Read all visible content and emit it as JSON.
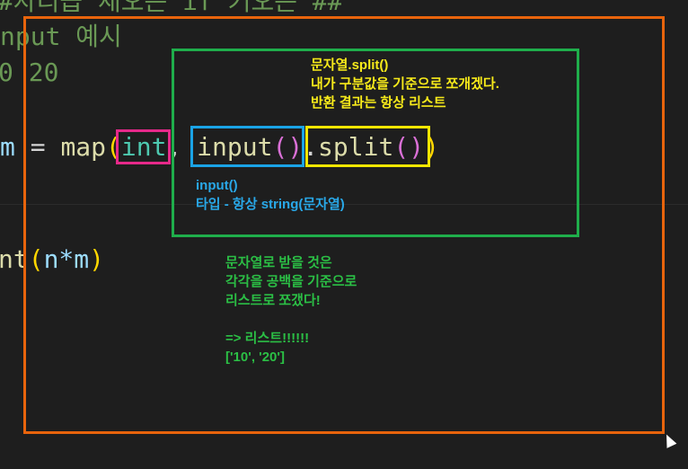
{
  "colors": {
    "background": "#1e1e1e",
    "orange_box": "#e8640c",
    "green_box": "#1fae4b",
    "pink_box": "#e6298a",
    "blue_box": "#1aa3e6",
    "yellow_box": "#f2e600",
    "yellow_text": "#f7ea1a",
    "blue_text": "#29a8e8",
    "green_text": "#2bbf45"
  },
  "code": {
    "line1": "#자리곱 새오는 if 커오는 ##",
    "line2": "nput 예시",
    "line3": "0 20",
    "line4_var": "m",
    "line4_eq": " = ",
    "line4_map": "map",
    "line4_lp": "(",
    "line4_int": "int",
    "line4_comma": ", ",
    "line4_input": "input",
    "line4_ip_l": "(",
    "line4_ip_r": ")",
    "line4_dot": ".",
    "line4_split": "split",
    "line4_sp_l": "(",
    "line4_sp_r": ")",
    "line4_rp": ")",
    "line6_fn": "nt",
    "line6_lp": "(",
    "line6_arg": "n*m",
    "line6_rp": ")"
  },
  "notes": {
    "split_title": "문자열.split()",
    "split_line2": "내가 구분값을 기준으로 쪼개겠다.",
    "split_line3": "반환 결과는 항상 리스트",
    "input_title": "input()",
    "input_line2": "타입 - 항상 string(문자열)",
    "result_line1": "문자열로 받을 것은",
    "result_line2": "각각을 공백을 기준으로",
    "result_line3": "리스트로 쪼갰다!",
    "result_line4": "=> 리스트!!!!!!",
    "result_line5": "['10', '20']"
  }
}
